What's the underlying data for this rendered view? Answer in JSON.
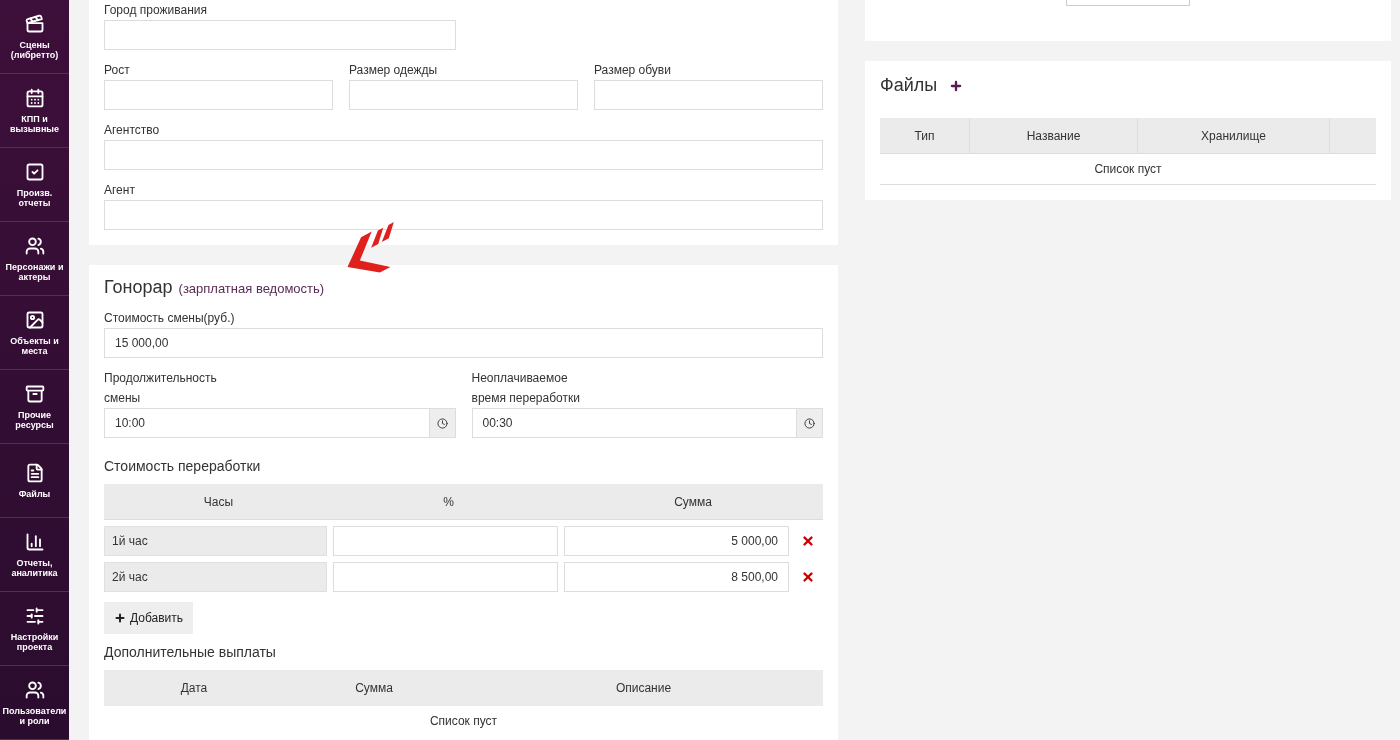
{
  "sidebar": {
    "items": [
      {
        "label": "Сцены (либретто)"
      },
      {
        "label": "КПП и вызывные"
      },
      {
        "label": "Произв. отчеты"
      },
      {
        "label": "Персонажи и актеры"
      },
      {
        "label": "Объекты и места"
      },
      {
        "label": "Прочие ресурсы"
      },
      {
        "label": "Файлы"
      },
      {
        "label": "Отчеты, аналитика"
      },
      {
        "label": "Настройки проекта"
      },
      {
        "label": "Пользователи и роли"
      }
    ]
  },
  "profile_form": {
    "city": {
      "label": "Город проживания"
    },
    "sizes": [
      {
        "label": "Рост"
      },
      {
        "label": "Размер одежды"
      },
      {
        "label": "Размер обуви"
      }
    ],
    "agency": {
      "label": "Агентство"
    },
    "agent": {
      "label": "Агент"
    }
  },
  "fee": {
    "title": "Гонорар",
    "subtitle": "(зарплатная ведомость)",
    "shift_cost": {
      "label": "Стоимость смены(руб.)",
      "value": "15 000,00"
    },
    "times": [
      {
        "label_lines": [
          "Продолжительность",
          "смены"
        ],
        "value": "10:00"
      },
      {
        "label_lines": [
          "Неоплачиваемое",
          "время переработки"
        ],
        "value": "00:30"
      }
    ],
    "overtime": {
      "title": "Стоимость переработки",
      "columns": [
        "Часы",
        "%",
        "Сумма"
      ],
      "rows": [
        {
          "hours": "1й час",
          "sum": "5 000,00"
        },
        {
          "hours": "2й час",
          "sum": "8 500,00"
        }
      ],
      "add_button": "Добавить"
    },
    "extra": {
      "title": "Дополнительные выплаты",
      "columns": [
        "Дата",
        "Сумма",
        "Описание"
      ],
      "empty": "Список пуст"
    }
  },
  "files": {
    "title": "Файлы",
    "columns": [
      "Тип",
      "Название",
      "Хранилище",
      ""
    ],
    "empty": "Список пуст"
  }
}
